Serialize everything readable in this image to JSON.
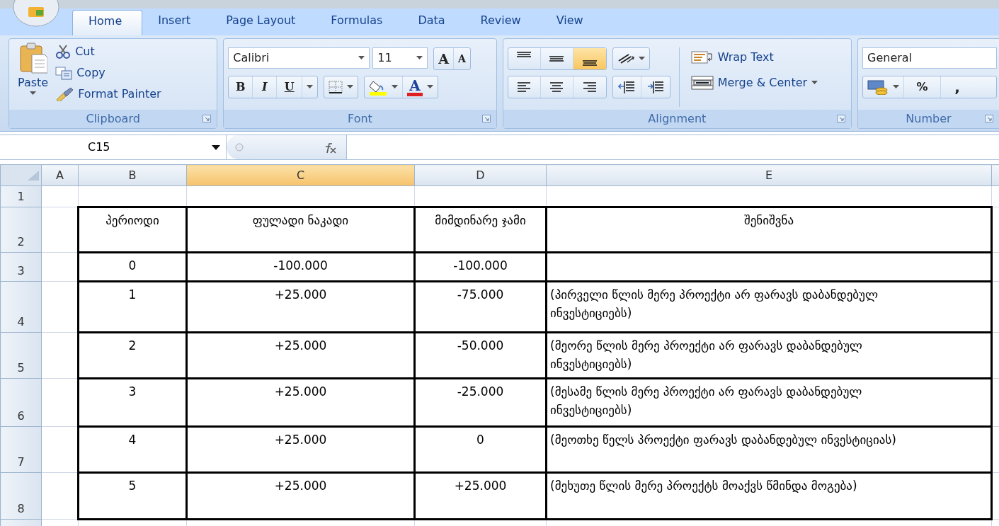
{
  "ribbon": {
    "tabs": [
      {
        "label": "Home",
        "selected": true
      },
      {
        "label": "Insert",
        "selected": false
      },
      {
        "label": "Page Layout",
        "selected": false
      },
      {
        "label": "Formulas",
        "selected": false
      },
      {
        "label": "Data",
        "selected": false
      },
      {
        "label": "Review",
        "selected": false
      },
      {
        "label": "View",
        "selected": false
      }
    ],
    "clipboard": {
      "title": "Clipboard",
      "paste": "Paste",
      "cut": "Cut",
      "copy": "Copy",
      "format_painter": "Format Painter"
    },
    "font": {
      "title": "Font",
      "font_name": "Calibri",
      "font_size": "11",
      "grow": "A",
      "shrink": "A",
      "bold": "B",
      "italic": "I",
      "underline": "U",
      "font_color": "A"
    },
    "alignment": {
      "title": "Alignment",
      "vertical": [
        {
          "kind": "top",
          "selected": false
        },
        {
          "kind": "middle",
          "selected": false
        },
        {
          "kind": "bottom",
          "selected": true
        }
      ],
      "wrap_text": "Wrap Text",
      "merge_center": "Merge & Center"
    },
    "number": {
      "title": "Number",
      "format": "General",
      "percent": "%",
      "comma": ","
    }
  },
  "formula_bar": {
    "name_box": "C15"
  },
  "sheet": {
    "columns": [
      {
        "label": "A",
        "selected": false
      },
      {
        "label": "B",
        "selected": false
      },
      {
        "label": "C",
        "selected": true
      },
      {
        "label": "D",
        "selected": false
      },
      {
        "label": "E",
        "selected": false
      }
    ],
    "rows": [
      {
        "kind": "empty",
        "number": "1"
      },
      {
        "kind": "header",
        "number": "2",
        "cells": [
          "პერიოდი",
          "ფულადი ნაკადი",
          "მიმდინარე ჯამი",
          "შენიშვნა"
        ]
      },
      {
        "kind": "data",
        "number": "3",
        "cells": [
          "0",
          "-100.000",
          "-100.000",
          ""
        ]
      },
      {
        "kind": "data",
        "number": "4",
        "cells": [
          "1",
          "+25.000",
          "-75.000",
          "(პირველი წლის მერე პროექტი არ ფარავს დაბანდებულ ინვესტიციებს)"
        ]
      },
      {
        "kind": "data",
        "number": "5",
        "cells": [
          "2",
          "+25.000",
          "-50.000",
          "(მეორე წლის მერე პროექტი არ ფარავს დაბანდებულ ინვესტიციებს)"
        ]
      },
      {
        "kind": "data",
        "number": "6",
        "cells": [
          "3",
          "+25.000",
          "-25.000",
          "(მესამე წლის მერე პროექტი არ ფარავს დაბანდებულ ინვესტიციებს)"
        ]
      },
      {
        "kind": "data",
        "number": "7",
        "cells": [
          "4",
          "+25.000",
          "0",
          "(მეოთხე წელს პროექტი ფარავს დაბანდებულ ინვესტიციას)"
        ]
      },
      {
        "kind": "data",
        "number": "8",
        "cells": [
          "5",
          "+25.000",
          "+25.000",
          "(მეხუთე წლის მერე პროექტს მოაქვს წმინდა მოგება)"
        ]
      },
      {
        "kind": "empty"
      }
    ]
  }
}
